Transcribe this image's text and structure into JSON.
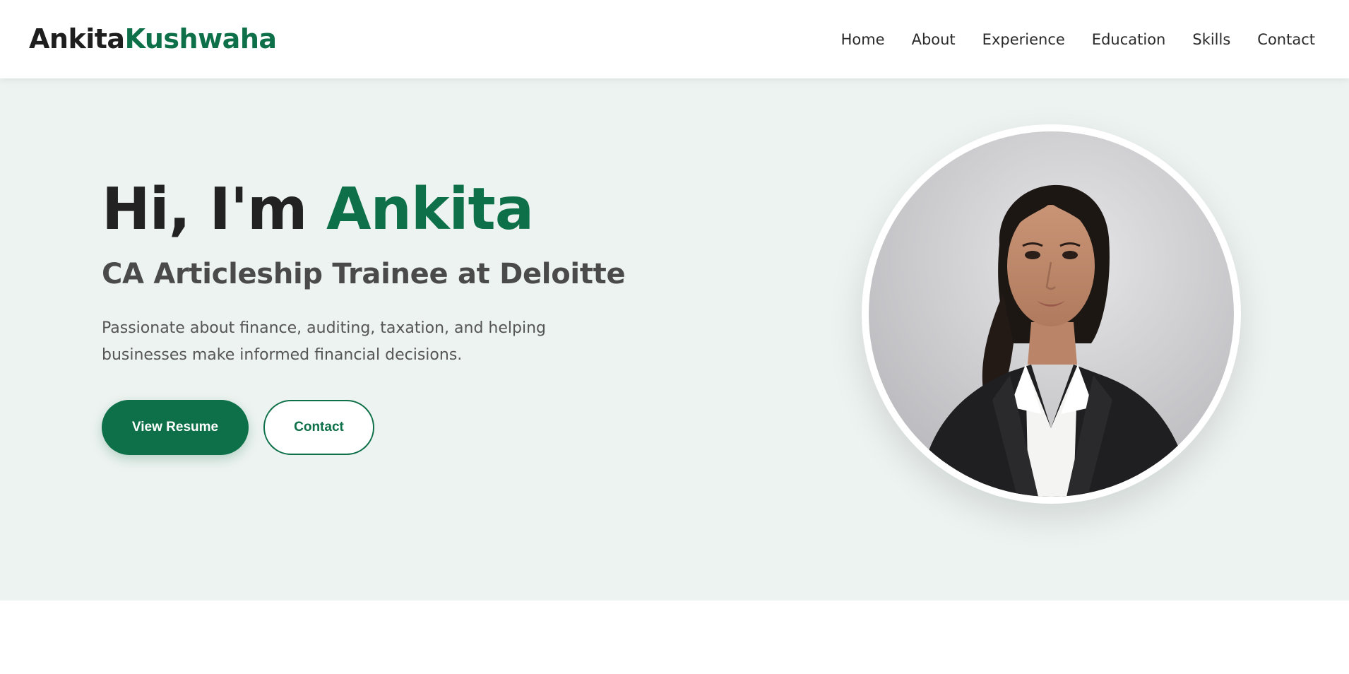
{
  "brand": {
    "first": "Ankita",
    "last": "Kushwaha"
  },
  "nav": {
    "items": [
      "Home",
      "About",
      "Experience",
      "Education",
      "Skills",
      "Contact"
    ]
  },
  "hero": {
    "greeting": "Hi, I'm ",
    "name": "Ankita",
    "subtitle": "CA Articleship Trainee at Deloitte",
    "description": "Passionate about finance, auditing, taxation, and helping businesses make informed financial decisions.",
    "primary_button": "View Resume",
    "secondary_button": "Contact",
    "portrait_icon": "profile-photo"
  },
  "colors": {
    "accent": "#0e7048",
    "hero_bg": "#edf3f1",
    "text_dark": "#222222",
    "text_muted": "#555555"
  }
}
